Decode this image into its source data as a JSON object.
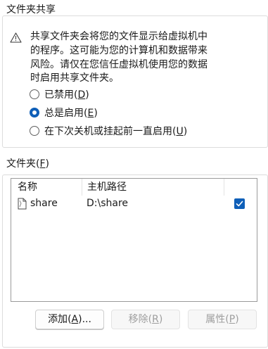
{
  "sharing_group": {
    "label_text": "文件夹共享",
    "warning_lines": [
      "共享文件夹会将您的文件显示给虚拟机中",
      "的程序。这可能为您的计算机和数据带来",
      "风险。请仅在您信任虚拟机使用您的数据",
      "时启用共享文件夹。"
    ],
    "options": [
      {
        "text": "已禁用",
        "mnemonic": "D",
        "checked": false
      },
      {
        "text": "总是启用",
        "mnemonic": "E",
        "checked": true
      },
      {
        "text": "在下次关机或挂起前一直启用",
        "mnemonic": "U",
        "checked": false
      }
    ]
  },
  "folders_group": {
    "label_text": "文件夹",
    "mnemonic": "F",
    "columns": [
      "名称",
      "主机路径"
    ],
    "rows": [
      {
        "name": "share",
        "host_path": "D:\\share",
        "enabled": true
      }
    ]
  },
  "buttons": {
    "add": {
      "text": "添加",
      "mnemonic": "A",
      "suffix": "...",
      "enabled": true
    },
    "remove": {
      "text": "移除",
      "mnemonic": "R",
      "enabled": false
    },
    "properties": {
      "text": "属性",
      "mnemonic": "P",
      "enabled": false
    }
  },
  "colors": {
    "accent": "#0f5fb8",
    "disabled_text": "#9e9e9e",
    "frame_border": "#dcdcdc"
  },
  "icons": {
    "warning": "warning-triangle-icon",
    "shared_folder": "file-icon",
    "checked": "checkmark-icon"
  }
}
